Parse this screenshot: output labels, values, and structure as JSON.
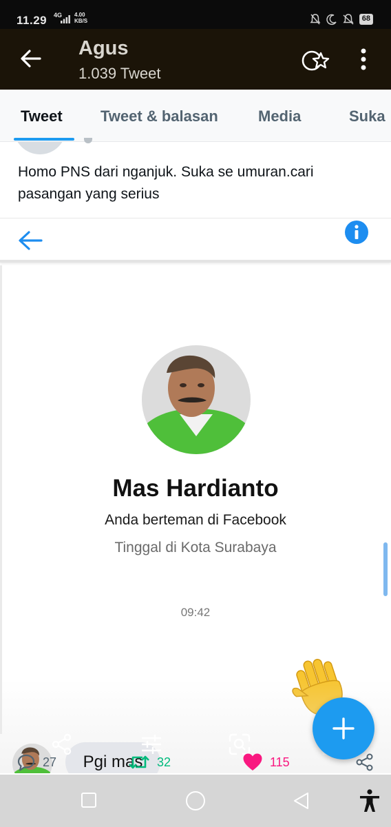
{
  "status_bar": {
    "time": "11.29",
    "network": "4G",
    "speed_value": "4.00",
    "speed_unit": "KB/S",
    "battery": "68"
  },
  "header": {
    "title": "Agus",
    "subtitle": "1.039 Tweet"
  },
  "tabs": [
    {
      "label": "Tweet",
      "active": true
    },
    {
      "label": "Tweet & balasan",
      "active": false
    },
    {
      "label": "Media",
      "active": false
    },
    {
      "label": "Suka",
      "active": false
    }
  ],
  "tweet": {
    "text": "Homo PNS dari nganjuk. Suka se umuran.cari pasangan yang serius"
  },
  "embedded_chat": {
    "contact_name": "Mas Hardianto",
    "relationship": "Anda berteman di Facebook",
    "location": "Tinggal di Kota Surabaya",
    "time": "09:42",
    "message": "Pgi mas",
    "wave_emoji": "waving-hand-icon"
  },
  "actions": {
    "replies": "27",
    "retweets": "32",
    "likes": "115"
  },
  "colors": {
    "accent": "#1d9bf0",
    "retweet": "#00ba7c",
    "like": "#f91880",
    "header_bg": "#1b1408"
  }
}
